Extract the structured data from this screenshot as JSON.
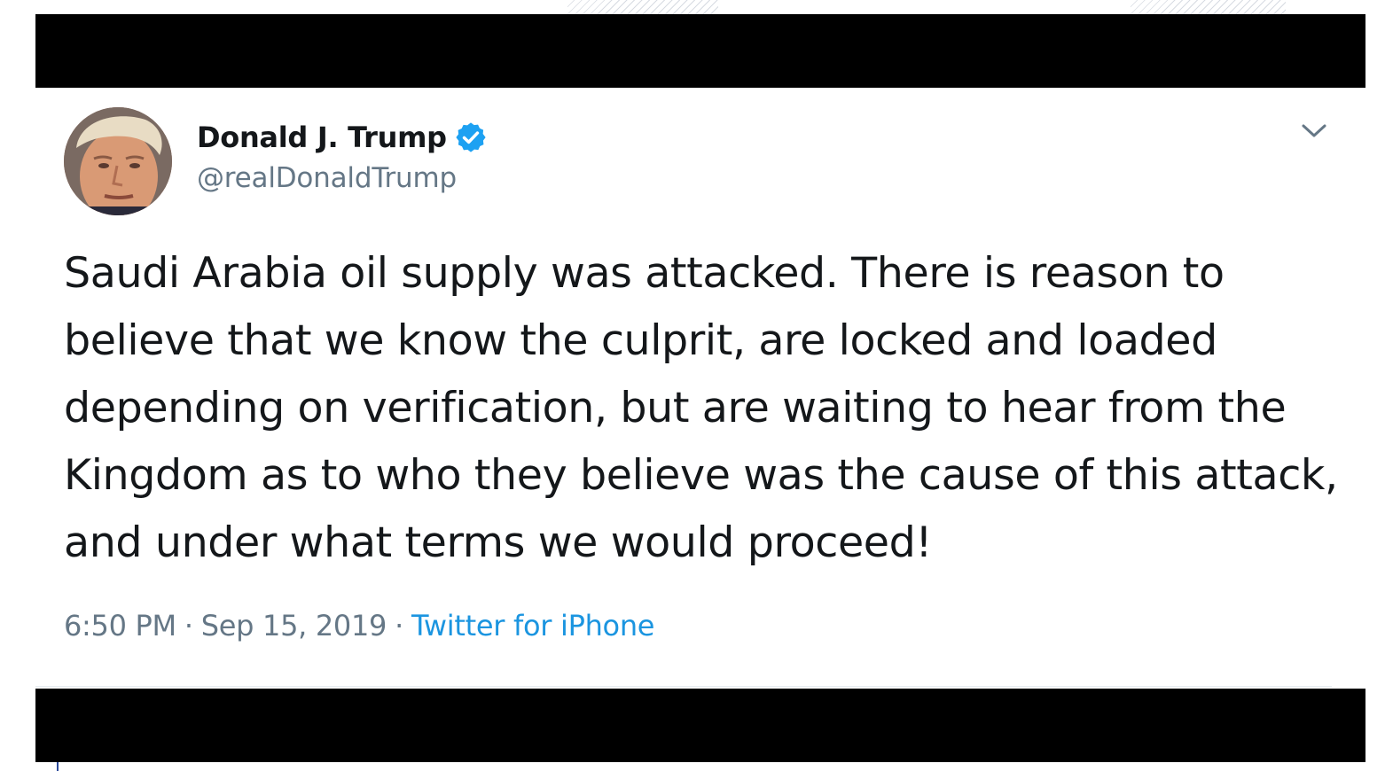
{
  "tweet": {
    "author": {
      "display_name": "Donald J. Trump",
      "handle": "@realDonaldTrump",
      "verified": true
    },
    "text": "Saudi Arabia oil supply was attacked. There is reason to believe that we know the culprit, are locked and loaded depending on verification, but are waiting to hear from the Kingdom as to who they believe was the cause of this attack, and under what terms we would proceed!",
    "time": "6:50 PM",
    "separator": "·",
    "date": "Sep 15, 2019",
    "source": "Twitter for iPhone"
  },
  "icons": {
    "verified": "verified-badge-icon",
    "more": "chevron-down-icon"
  },
  "colors": {
    "verified_blue": "#1da1f2",
    "source_link": "#1b95e0",
    "secondary_text": "#657786",
    "primary_text": "#14171a",
    "bars": "#000000"
  }
}
